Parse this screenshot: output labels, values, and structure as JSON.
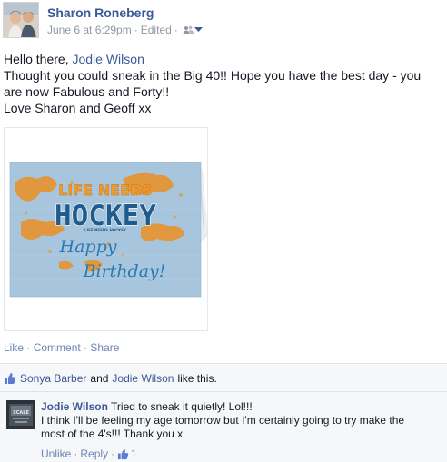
{
  "post": {
    "author": "Sharon Roneberg",
    "timestamp": "June 6 at 6:29pm",
    "separator": "·",
    "edited": "Edited",
    "audience_icon": "friends-icon",
    "greeting_prefix": "Hello there, ",
    "tagged_name": "Jodie Wilson",
    "line2": "Thought you could sneak in the Big 40!! Hope you have the best day - you",
    "line3": "are now Fabulous and Forty!!",
    "line4": "Love Sharon and Geoff xx",
    "photo": {
      "card_title_top": "LIFE NEEDS",
      "card_title_main": "HOCKEY",
      "card_title_small": "LIFE NEEDS HOCKEY",
      "card_line1": "Happy",
      "card_line2": "Birthday!"
    },
    "actions": {
      "like": "Like",
      "comment": "Comment",
      "share": "Share"
    }
  },
  "likes": {
    "icon": "thumbs-up-icon",
    "name1": "Sonya Barber",
    "and": "and",
    "name2": "Jodie Wilson",
    "suffix": "like this."
  },
  "comment": {
    "author": "Jodie Wilson",
    "text1": "Tried to sneak it quietly! Lol!!!",
    "text2": "I think I'll be feeling my age tomorrow but I'm certainly going to try make the",
    "text3": "most of the 4's!!! Thank you x",
    "unlike": "Unlike",
    "reply": "Reply",
    "like_count": "1",
    "avatar_text": "SCALE"
  },
  "colors": {
    "link": "#3b5998",
    "muted": "#9197a3",
    "action": "#6d84b4",
    "card_blue": "#a7c6de",
    "card_orange": "#e8922c",
    "hockey_blue": "#1e5c8e"
  }
}
